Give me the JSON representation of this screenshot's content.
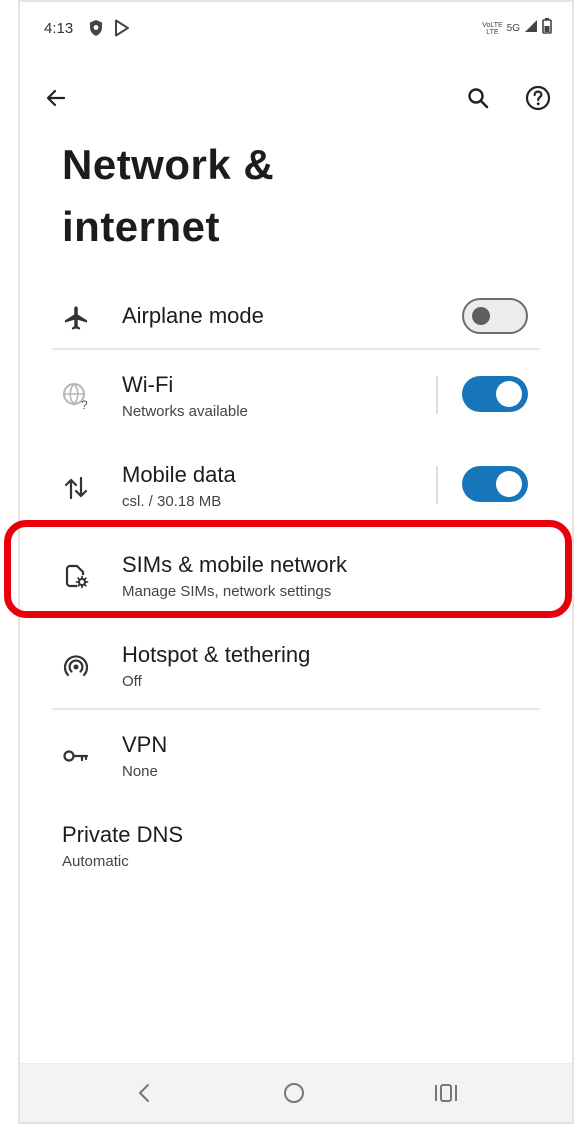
{
  "status_bar": {
    "time": "4:13",
    "volte_top": "VoLTE",
    "volte_bottom": "LTE",
    "network": "5G"
  },
  "header": {
    "title_line1": "Network &",
    "title_line2": "internet"
  },
  "items": [
    {
      "title": "Airplane mode",
      "subtitle": "",
      "icon": "airplane-icon",
      "toggle": "off"
    },
    {
      "title": "Wi-Fi",
      "subtitle": "Networks available",
      "icon": "wifi-unknown-icon",
      "toggle": "on"
    },
    {
      "title": "Mobile data",
      "subtitle": "csl. / 30.18 MB",
      "icon": "data-arrows-icon",
      "toggle": "on"
    },
    {
      "title": "SIMs & mobile network",
      "subtitle": "Manage SIMs, network settings",
      "icon": "sim-settings-icon"
    },
    {
      "title": "Hotspot & tethering",
      "subtitle": "Off",
      "icon": "hotspot-icon"
    },
    {
      "title": "VPN",
      "subtitle": "None",
      "icon": "vpn-key-icon"
    },
    {
      "title": "Private DNS",
      "subtitle": "Automatic"
    }
  ],
  "colors": {
    "toggle_on": "#1776b9",
    "highlight": "#e8000b"
  }
}
